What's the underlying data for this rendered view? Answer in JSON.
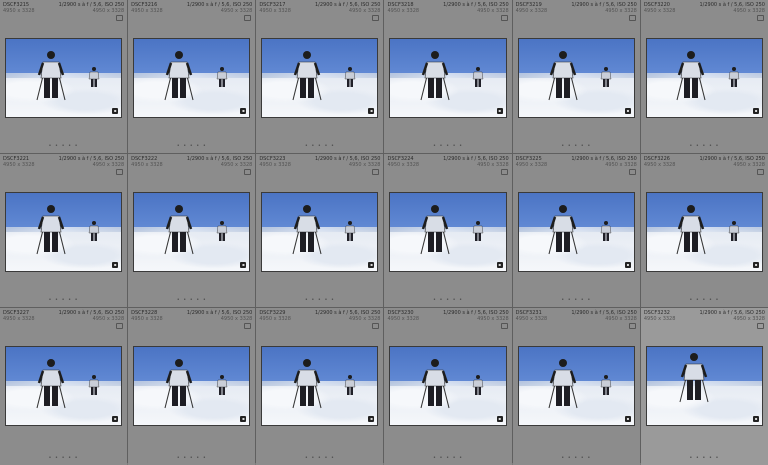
{
  "library": {
    "photos": [
      {
        "filename": "DSCF3215",
        "exif": "1/2900 s à f / 5,6, ISO 250",
        "dims": "4950 x 3328"
      },
      {
        "filename": "DSCF3216",
        "exif": "1/2900 s à f / 5,6, ISO 250",
        "dims": "4950 x 3328"
      },
      {
        "filename": "DSCF3217",
        "exif": "1/2900 s à f / 5,6, ISO 250",
        "dims": "4950 x 3328"
      },
      {
        "filename": "DSCF3218",
        "exif": "1/2900 s à f / 5,6, ISO 250",
        "dims": "4950 x 3328"
      },
      {
        "filename": "DSCF3219",
        "exif": "1/2900 s à f / 5,6, ISO 250",
        "dims": "4950 x 3328"
      },
      {
        "filename": "DSCF3220",
        "exif": "1/2900 s à f / 5,6, ISO 250",
        "dims": "4950 x 3328"
      },
      {
        "filename": "DSCF3221",
        "exif": "1/2900 s à f / 5,6, ISO 250",
        "dims": "4950 x 3328"
      },
      {
        "filename": "DSCF3222",
        "exif": "1/2900 s à f / 5,6, ISO 250",
        "dims": "4950 x 3328"
      },
      {
        "filename": "DSCF3223",
        "exif": "1/2900 s à f / 5,6, ISO 250",
        "dims": "4950 x 3328"
      },
      {
        "filename": "DSCF3224",
        "exif": "1/2900 s à f / 5,6, ISO 250",
        "dims": "4950 x 3328"
      },
      {
        "filename": "DSCF3225",
        "exif": "1/2900 s à f / 5,6, ISO 250",
        "dims": "4950 x 3328"
      },
      {
        "filename": "DSCF3226",
        "exif": "1/2900 s à f / 5,6, ISO 250",
        "dims": "4950 x 3328"
      },
      {
        "filename": "DSCF3227",
        "exif": "1/2900 s à f / 5,6, ISO 250",
        "dims": "4950 x 3328"
      },
      {
        "filename": "DSCF3228",
        "exif": "1/2900 s à f / 5,6, ISO 250",
        "dims": "4950 x 3328"
      },
      {
        "filename": "DSCF3229",
        "exif": "1/2900 s à f / 5,6, ISO 250",
        "dims": "4950 x 3328"
      },
      {
        "filename": "DSCF3230",
        "exif": "1/2900 s à f / 5,6, ISO 250",
        "dims": "4950 x 3328"
      },
      {
        "filename": "DSCF3231",
        "exif": "1/2900 s à f / 5,6, ISO 250",
        "dims": "4950 x 3328"
      },
      {
        "filename": "DSCF3232",
        "exif": "1/2900 s à f / 5,6, ISO 250",
        "dims": "4950 x 3328",
        "closeup": true
      }
    ],
    "footer_dots": "• • • • •",
    "colors": {
      "sky": "#4b74c4",
      "cell": "#8c8c8c",
      "grid": "#5f5f5f"
    },
    "icons": {
      "edited_badge": "edit-badge-icon",
      "flag": "flag-icon"
    }
  }
}
